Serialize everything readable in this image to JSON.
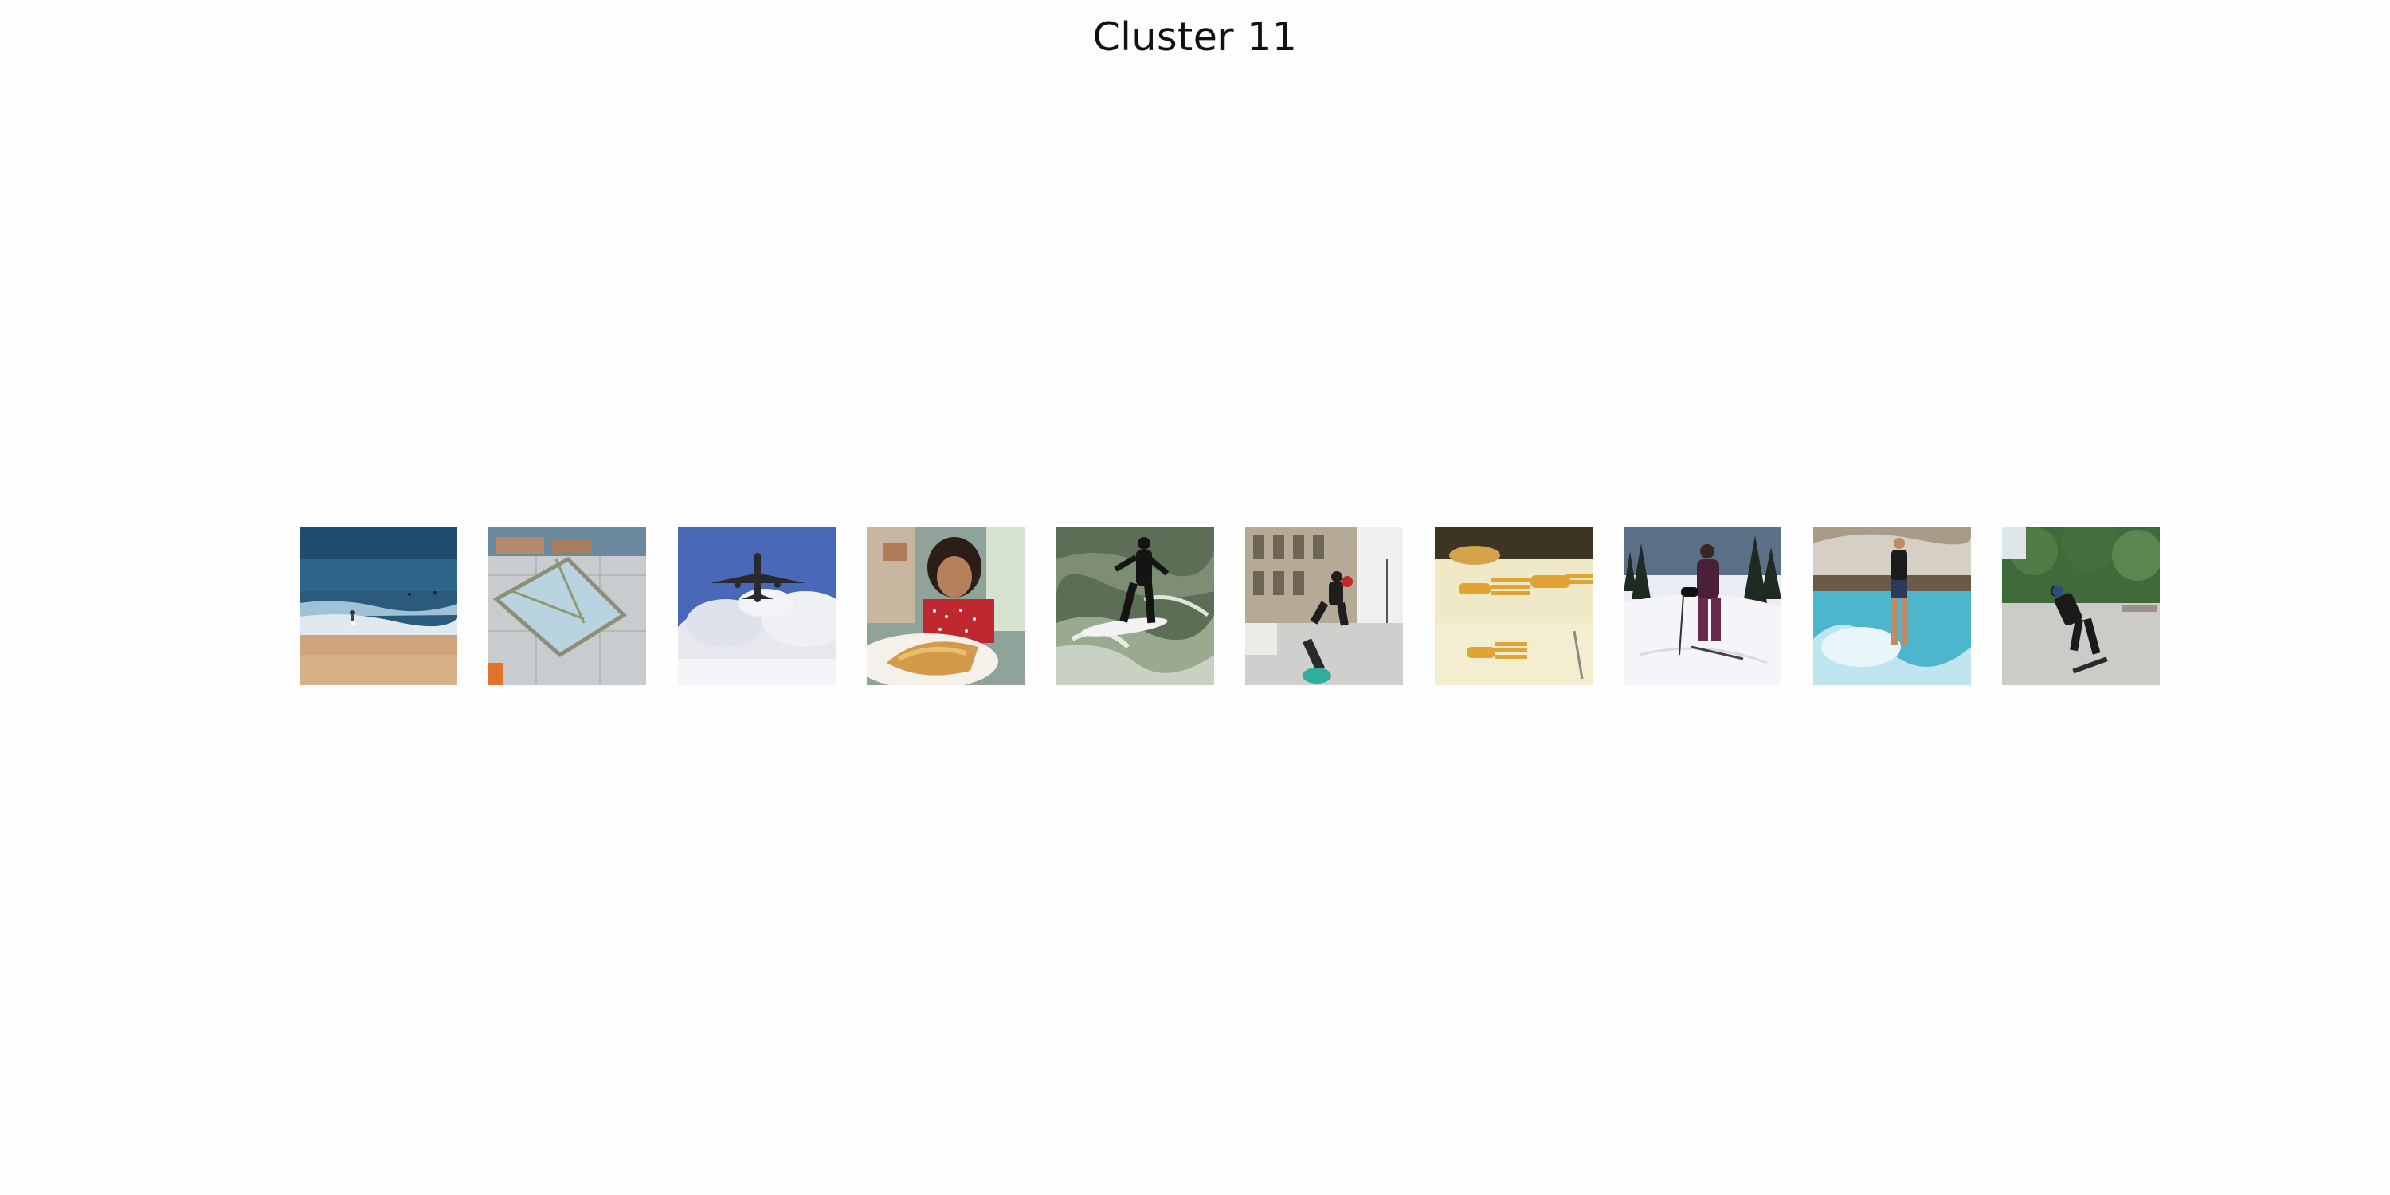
{
  "figure": {
    "title": "Cluster 11",
    "background": "#fefefe"
  },
  "thumbnails": [
    {
      "subject": "beach-shore-with-waves"
    },
    {
      "subject": "hands-with-kite-frame-on-tile-floor"
    },
    {
      "subject": "airplane-overhead-in-cloudy-sky"
    },
    {
      "subject": "girl-with-pizza-slice"
    },
    {
      "subject": "surfer-on-wave"
    },
    {
      "subject": "skateboarder-jumping-on-sidewalk"
    },
    {
      "subject": "wooden-forks-display"
    },
    {
      "subject": "skier-on-snowy-slope"
    },
    {
      "subject": "person-wading-in-water"
    },
    {
      "subject": "skateboarder-in-plaza"
    }
  ]
}
